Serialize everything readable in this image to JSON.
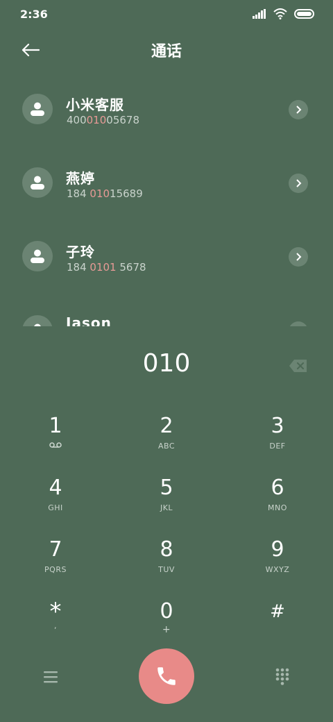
{
  "status": {
    "time": "2:36"
  },
  "header": {
    "title": "通话"
  },
  "contacts": [
    {
      "name": "小米客服",
      "number_parts": [
        "400",
        "010",
        "05678"
      ]
    },
    {
      "name": "燕婷",
      "number_parts": [
        "184 ",
        "010",
        "15689"
      ]
    },
    {
      "name": "子玲",
      "number_parts": [
        "184 ",
        "0101",
        " 5678"
      ]
    },
    {
      "name": "Jason",
      "number_parts": [
        "",
        "",
        ""
      ]
    }
  ],
  "dialer": {
    "input": "010"
  },
  "keypad": [
    {
      "digit": "1",
      "letters": ""
    },
    {
      "digit": "2",
      "letters": "ABC"
    },
    {
      "digit": "3",
      "letters": "DEF"
    },
    {
      "digit": "4",
      "letters": "GHI"
    },
    {
      "digit": "5",
      "letters": "JKL"
    },
    {
      "digit": "6",
      "letters": "MNO"
    },
    {
      "digit": "7",
      "letters": "PQRS"
    },
    {
      "digit": "8",
      "letters": "TUV"
    },
    {
      "digit": "9",
      "letters": "WXYZ"
    },
    {
      "digit": "*",
      "letters": ","
    },
    {
      "digit": "0",
      "letters": "+"
    },
    {
      "digit": "#",
      "letters": ""
    }
  ],
  "colors": {
    "background": "#4e6a57",
    "accent": "#e88a88",
    "highlight": "#e89a96"
  }
}
